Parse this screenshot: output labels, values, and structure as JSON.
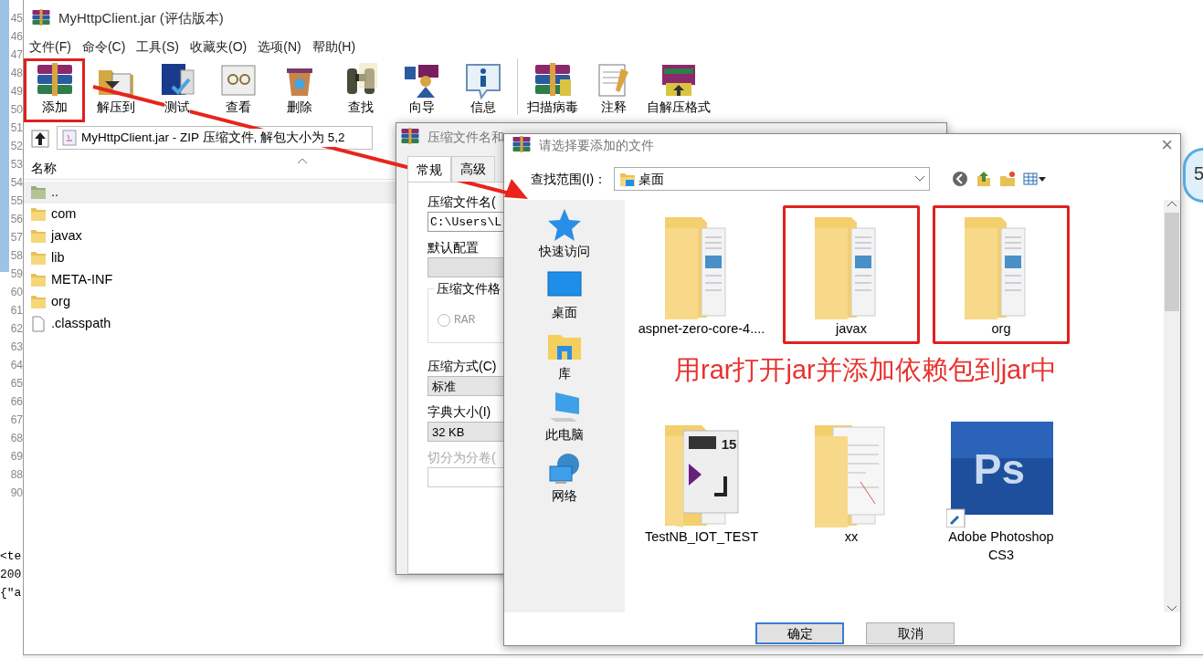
{
  "editor": {
    "line_numbers": [
      "45",
      "46",
      "47",
      "48",
      "49",
      "50",
      "51",
      "52",
      "53",
      "54",
      "55",
      "56",
      "57",
      "58",
      "59",
      "60",
      "61",
      "62",
      "63",
      "64",
      "65",
      "66",
      "67",
      "68",
      "69",
      "88",
      "90"
    ],
    "code_lines": [
      "<te",
      "200",
      "{\"a"
    ]
  },
  "main_window": {
    "title": "MyHttpClient.jar (评估版本)",
    "menu": [
      "文件(F)",
      "命令(C)",
      "工具(S)",
      "收藏夹(O)",
      "选项(N)",
      "帮助(H)"
    ],
    "toolbar": [
      {
        "kind": "add",
        "label": "添加",
        "highlighted": true
      },
      {
        "kind": "extract",
        "label": "解压到",
        "highlighted": false
      },
      {
        "kind": "test",
        "label": "测试",
        "highlighted": false
      },
      {
        "kind": "view",
        "label": "查看",
        "highlighted": false
      },
      {
        "kind": "delete",
        "label": "删除",
        "highlighted": false
      },
      {
        "kind": "find",
        "label": "查找",
        "highlighted": false
      },
      {
        "kind": "wizard",
        "label": "向导",
        "highlighted": false
      },
      {
        "kind": "info",
        "label": "信息",
        "highlighted": false
      },
      {
        "kind": "scan",
        "label": "扫描病毒",
        "highlighted": false
      },
      {
        "kind": "comment",
        "label": "注释",
        "highlighted": false
      },
      {
        "kind": "sfx",
        "label": "自解压格式",
        "highlighted": false
      }
    ],
    "address": "MyHttpClient.jar - ZIP 压缩文件, 解包大小为 5,2",
    "column": "名称",
    "files": [
      {
        "kind": "parent",
        "name": "..",
        "selected": true
      },
      {
        "kind": "folder",
        "name": "com",
        "selected": false
      },
      {
        "kind": "folder",
        "name": "javax",
        "selected": false
      },
      {
        "kind": "folder",
        "name": "lib",
        "selected": false
      },
      {
        "kind": "folder",
        "name": "META-INF",
        "selected": false
      },
      {
        "kind": "folder",
        "name": "org",
        "selected": false
      },
      {
        "kind": "file",
        "name": ".classpath",
        "selected": false
      }
    ]
  },
  "archive_dialog": {
    "title": "压缩文件名和",
    "tabs": [
      {
        "label": "常规",
        "selected": true
      },
      {
        "label": "高级",
        "selected": false
      }
    ],
    "fields": [
      {
        "kind": "label",
        "text": "压缩文件名(",
        "disabled": false
      },
      {
        "kind": "input",
        "value": "C:\\Users\\L",
        "disabled": false
      },
      {
        "kind": "label",
        "text": "默认配置",
        "disabled": false
      },
      {
        "kind": "button",
        "disabled": false
      },
      {
        "kind": "group",
        "legend": "压缩文件格",
        "disabled": false,
        "options": [
          {
            "label": "RAR",
            "selected": false
          }
        ]
      },
      {
        "kind": "label",
        "text": "压缩方式(C)",
        "disabled": false
      },
      {
        "kind": "select",
        "value": "标准",
        "disabled": false
      },
      {
        "kind": "label",
        "text": "字典大小(I)",
        "disabled": false
      },
      {
        "kind": "select",
        "value": "32 KB",
        "disabled": false
      },
      {
        "kind": "label",
        "text": "切分为分卷(",
        "disabled": true
      },
      {
        "kind": "input",
        "disabled": true
      }
    ]
  },
  "file_dialog": {
    "title": "请选择要添加的文件",
    "close": "×",
    "look_in_label": "查找范围(I)：",
    "look_in_value": "桌面",
    "places": [
      {
        "kind": "quick",
        "label": "快速访问"
      },
      {
        "kind": "desktop",
        "label": "桌面"
      },
      {
        "kind": "library",
        "label": "库"
      },
      {
        "kind": "computer",
        "label": "此电脑"
      },
      {
        "kind": "network",
        "label": "网络"
      }
    ],
    "items": [
      {
        "kind": "folder",
        "name": "aspnet-zero-core-4....",
        "highlighted": false
      },
      {
        "kind": "folder",
        "name": "javax",
        "highlighted": true
      },
      {
        "kind": "folder",
        "name": "org",
        "highlighted": true
      },
      {
        "kind": "project",
        "name": "TestNB_IOT_TEST",
        "badge": "15",
        "highlighted": false
      },
      {
        "kind": "docs",
        "name": "xx",
        "highlighted": false
      },
      {
        "kind": "app",
        "name": "Adobe Photoshop CS3",
        "badge": "Ps",
        "highlighted": false
      }
    ],
    "buttons": [
      {
        "label": "确定",
        "default": true
      },
      {
        "label": "取消",
        "default": false
      }
    ]
  },
  "annotation": {
    "text": "用rar打开jar并添加依赖包到jar中"
  },
  "side_widget": {
    "text": "5"
  }
}
